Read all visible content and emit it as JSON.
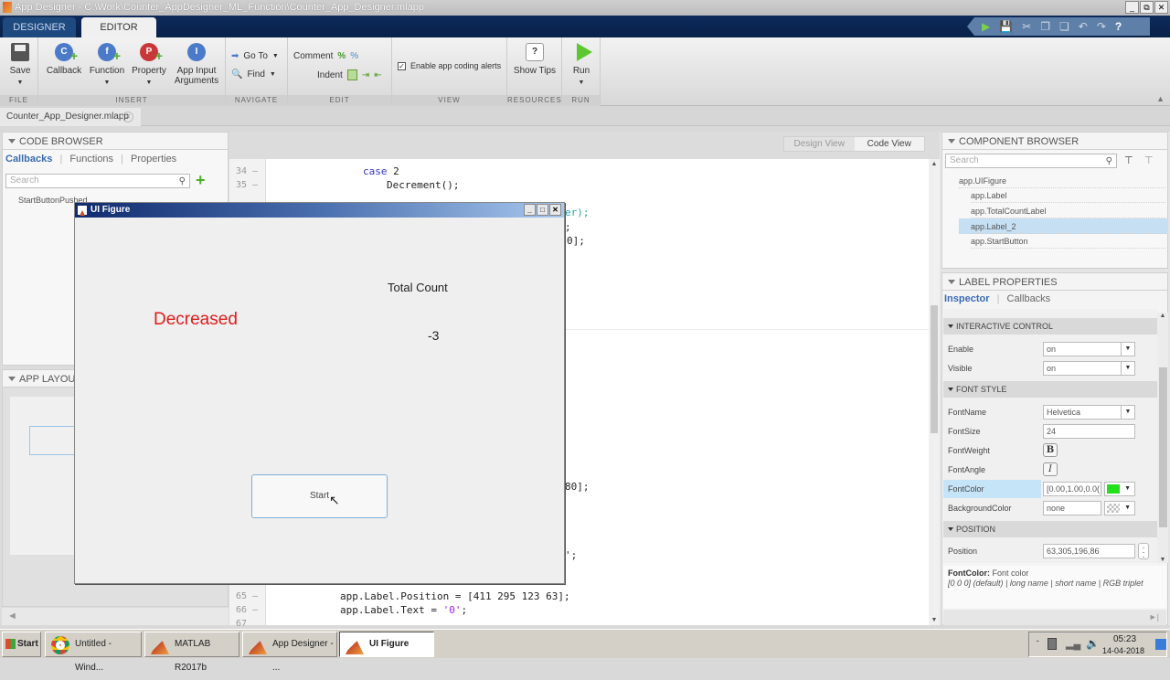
{
  "window": {
    "title": "App Designer - C:\\Work\\Counter_AppDesigner_ML_Function\\Counter_App_Designer.mlapp",
    "controls": [
      "_",
      "⧉",
      "✕"
    ]
  },
  "ribbon_tabs": [
    {
      "label": "DESIGNER",
      "active": false
    },
    {
      "label": "EDITOR",
      "active": true
    }
  ],
  "quick_access": [
    "run-icon",
    "save-icon",
    "cut-icon",
    "copy-icon",
    "paste-icon",
    "undo-icon",
    "redo-icon",
    "help-icon"
  ],
  "ribbon": {
    "file": {
      "label": "FILE",
      "save": "Save"
    },
    "insert": {
      "label": "INSERT",
      "callback": "Callback",
      "function": "Function",
      "property": "Property",
      "app_input": "App Input Arguments"
    },
    "navigate": {
      "label": "NAVIGATE",
      "goto": "Go To",
      "find": "Find"
    },
    "edit": {
      "label": "EDIT",
      "comment": "Comment",
      "indent": "Indent"
    },
    "view": {
      "label": "VIEW",
      "coding_alerts": "Enable app coding alerts",
      "coding_alerts_checked": true
    },
    "resources": {
      "label": "RESOURCES",
      "show_tips": "Show Tips"
    },
    "run": {
      "label": "RUN",
      "run": "Run"
    }
  },
  "document_tab": {
    "label": "Counter_App_Designer.mlapp"
  },
  "code_browser": {
    "title": "CODE BROWSER",
    "tabs": [
      "Callbacks",
      "Functions",
      "Properties"
    ],
    "active_tab": "Callbacks",
    "search_placeholder": "Search",
    "items": [
      "StartButtonPushed"
    ]
  },
  "app_layout": {
    "title": "APP LAYOUT"
  },
  "editor": {
    "view_toggle": {
      "design": "Design View",
      "code": "Code View",
      "active": "Code View"
    },
    "lines": [
      {
        "num": "34",
        "code_kw": "case",
        "code_rest": " 2"
      },
      {
        "num": "35",
        "code": "Decrement();"
      },
      {
        "num": "65",
        "code": "app.Label.Position = [411 295 123 63];"
      },
      {
        "num": "66",
        "code_pre": "app.Label.Text = ",
        "code_str": "'0'",
        "code_post": ";"
      },
      {
        "num": "67",
        "code": ""
      }
    ],
    "fragments": [
      "er);",
      ";",
      "0];",
      "80];",
      "';"
    ]
  },
  "ui_figure": {
    "title": "UI Figure",
    "status_label": "Decreased",
    "status_color": "#e01b1b",
    "total_label": "Total Count",
    "count_value": "-3",
    "start_button": "Start"
  },
  "component_browser": {
    "title": "COMPONENT BROWSER",
    "search_placeholder": "Search",
    "root": "app.UIFigure",
    "children": [
      "app.Label",
      "app.TotalCountLabel",
      "app.Label_2",
      "app.StartButton"
    ],
    "selected": "app.Label_2"
  },
  "label_properties": {
    "title": "LABEL PROPERTIES",
    "tabs": [
      "Inspector",
      "Callbacks"
    ],
    "active_tab": "Inspector",
    "groups": {
      "interactive": "INTERACTIVE CONTROL",
      "font": "FONT STYLE",
      "position": "POSITION"
    },
    "enable": {
      "label": "Enable",
      "value": "on"
    },
    "visible": {
      "label": "Visible",
      "value": "on"
    },
    "font_name": {
      "label": "FontName",
      "value": "Helvetica"
    },
    "font_size": {
      "label": "FontSize",
      "value": "24"
    },
    "font_weight": {
      "label": "FontWeight",
      "glyph": "B"
    },
    "font_angle": {
      "label": "FontAngle",
      "glyph": "I"
    },
    "font_color": {
      "label": "FontColor",
      "value": "[0.00,1.00,0.0(",
      "swatch": "#22e01a"
    },
    "background_color": {
      "label": "BackgroundColor",
      "value": "none"
    },
    "position": {
      "label": "Position",
      "value": "63,305,196,86"
    },
    "help": {
      "name": "FontColor:",
      "desc": "Font color",
      "detail": "[0 0 0] (default) | long name | short name | RGB triplet"
    }
  },
  "taskbar": {
    "start": "Start",
    "items": [
      "Untitled - Wind...",
      "MATLAB R2017b",
      "App Designer - ...",
      "UI Figure"
    ],
    "active": "UI Figure",
    "time": "05:23",
    "date": "14-04-2018"
  }
}
